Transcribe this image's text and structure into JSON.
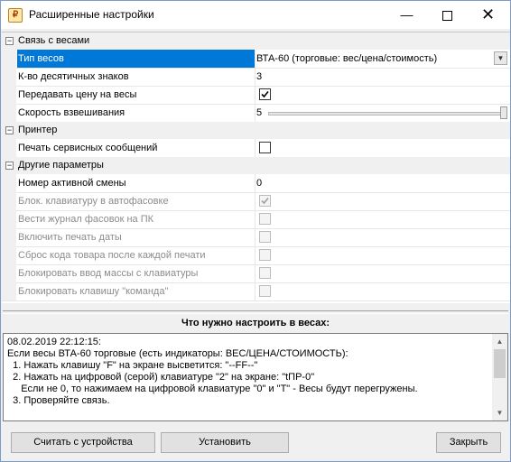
{
  "window": {
    "title": "Расширенные настройки",
    "min_glyph": "—",
    "close_glyph": "✕"
  },
  "categories": [
    {
      "label": "Связь с весами",
      "toggle": "−"
    },
    {
      "label": "Принтер",
      "toggle": "−"
    },
    {
      "label": "Другие параметры",
      "toggle": "−"
    }
  ],
  "rows": {
    "scale_type": {
      "label": "Тип весов",
      "value": "ВТА-60 (торговые: вес/цена/стоимость)"
    },
    "decimals": {
      "label": "К-во десятичных знаков",
      "value": "3"
    },
    "send_price": {
      "label": "Передавать цену на весы",
      "checked": true
    },
    "speed": {
      "label": "Скорость взвешивания",
      "value": "5",
      "level": 1.0
    },
    "print_service": {
      "label": "Печать сервисных сообщений",
      "checked": false
    },
    "shift_number": {
      "label": "Номер активной смены",
      "value": "0"
    },
    "lock_keyboard": {
      "label": "Блок. клавиатуру в автофасовке",
      "checked": true,
      "disabled": true
    },
    "journal": {
      "label": "Вести журнал фасовок на ПК",
      "checked": false,
      "disabled": true
    },
    "print_date": {
      "label": "Включить печать даты",
      "checked": false,
      "disabled": true
    },
    "reset_code": {
      "label": "Сброс кода товара после каждой печати",
      "checked": false,
      "disabled": true
    },
    "lock_mass": {
      "label": "Блокировать ввод массы с клавиатуры",
      "checked": false,
      "disabled": true
    },
    "lock_command": {
      "label": "Блокировать клавишу \"команда\"",
      "checked": false,
      "disabled": true
    }
  },
  "info": {
    "header": "Что нужно настроить в весах:",
    "lines": [
      "08.02.2019 22:12:15:",
      "Если весы ВТА-60 торговые (есть индикаторы: ВЕС/ЦЕНА/СТОИМОСТЬ):",
      "  1. Нажать клавишу \"F\" на экране высветится: \"--FF--\"",
      "  2. Нажать на цифровой (серой) клавиатуре \"2\" на экране: \"tПР-0\"",
      "     Если не 0, то нажимаем на цифровой клавиатуре \"0\" и \"Т\" - Весы будут перегружены.",
      "  3. Проверяйте связь."
    ]
  },
  "buttons": {
    "read": "Считать с устройства",
    "set": "Установить",
    "close": "Закрыть"
  }
}
